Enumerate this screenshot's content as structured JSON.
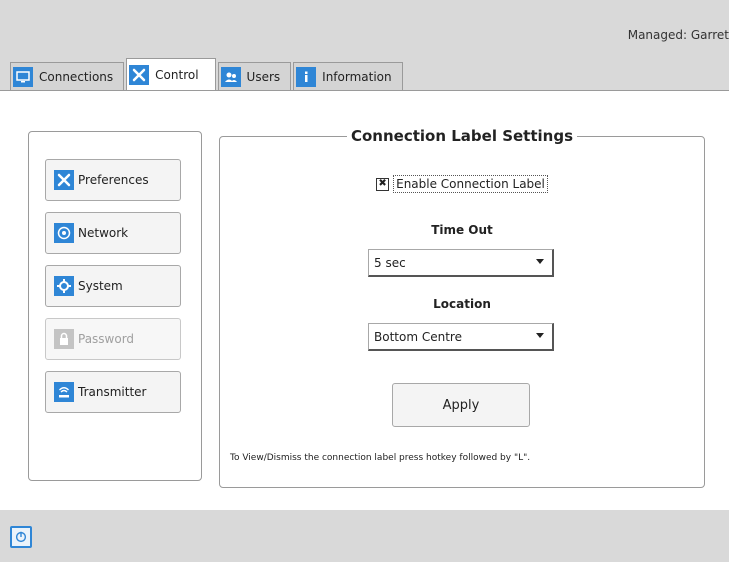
{
  "header": {
    "managed_text": "Managed:  Garret"
  },
  "tabs": [
    {
      "label": "Connections",
      "icon": "monitor-icon"
    },
    {
      "label": "Control",
      "icon": "tools-icon"
    },
    {
      "label": "Users",
      "icon": "users-icon"
    },
    {
      "label": "Information",
      "icon": "info-icon"
    }
  ],
  "sidebar": {
    "items": [
      {
        "label": "Preferences",
        "icon": "tools-icon",
        "disabled": false
      },
      {
        "label": "Network",
        "icon": "network-icon",
        "disabled": false
      },
      {
        "label": "System",
        "icon": "gear-icon",
        "disabled": false
      },
      {
        "label": "Password",
        "icon": "lock-icon",
        "disabled": true
      },
      {
        "label": "Transmitter",
        "icon": "transmitter-icon",
        "disabled": false
      }
    ]
  },
  "settings": {
    "title": "Connection Label Settings",
    "enable_label": "Enable Connection Label",
    "enable_checked": true,
    "timeout_label": "Time Out",
    "timeout_value": "5 sec",
    "location_label": "Location",
    "location_value": "Bottom Centre",
    "apply_label": "Apply",
    "hint": "To View/Dismiss the connection label press hotkey followed by \"L\"."
  },
  "colors": {
    "accent": "#2f86d6",
    "bar_background": "#d9d9d9"
  }
}
